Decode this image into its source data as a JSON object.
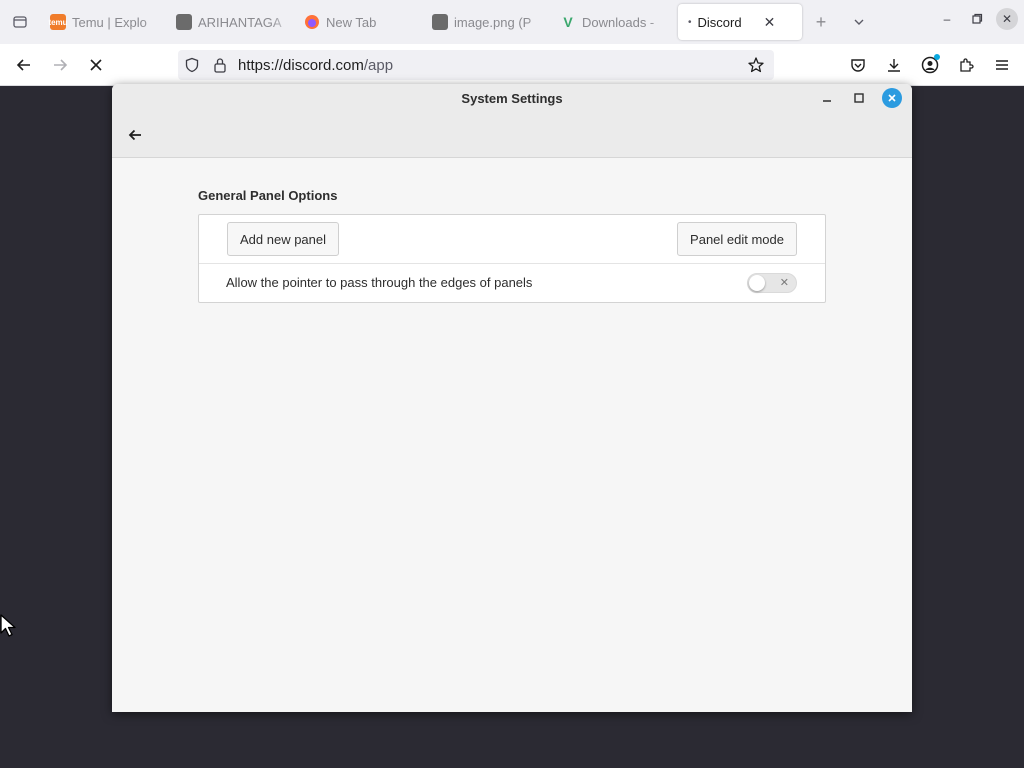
{
  "browser": {
    "tabs": [
      {
        "label": "Temu | Explo",
        "favicon": "temu-icon",
        "favicon_text": "temu",
        "favicon_color": "#f07c2a"
      },
      {
        "label": "ARIHANTAGA",
        "favicon": "image-icon",
        "favicon_text": "",
        "favicon_color": "#6b6b6b"
      },
      {
        "label": "New Tab",
        "favicon": "firefox-icon",
        "favicon_text": "",
        "favicon_color": "#e66000"
      },
      {
        "label": "image.png (P",
        "favicon": "image-icon",
        "favicon_text": "",
        "favicon_color": "#6b6b6b"
      },
      {
        "label": "Downloads -",
        "favicon": "v-logo-icon",
        "favicon_text": "V",
        "favicon_color": "#3aa76d"
      }
    ],
    "active_tab": {
      "label": "Discord",
      "indicator": "•"
    },
    "url": {
      "host": "https://discord.com",
      "path": "/app"
    }
  },
  "dialog": {
    "title": "System Settings",
    "section_title": "General Panel Options",
    "add_panel_label": "Add new panel",
    "edit_mode_label": "Panel edit mode",
    "pointer_option_label": "Allow the pointer to pass through the edges of panels",
    "pointer_option_enabled": false,
    "accent_color": "#2b9be0"
  }
}
